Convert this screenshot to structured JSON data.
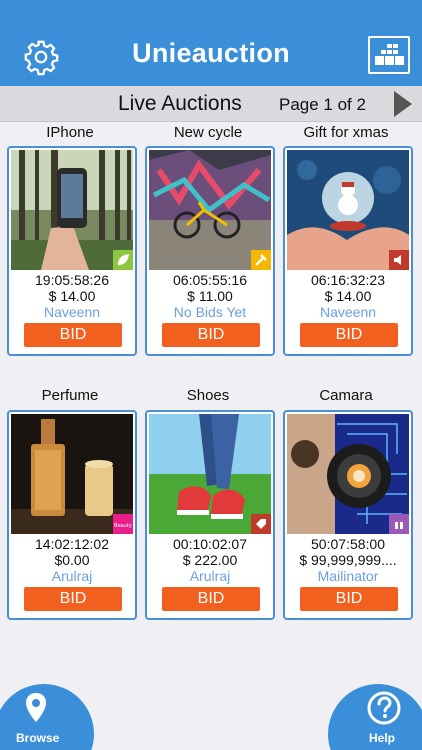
{
  "header": {
    "title": "Unieauction",
    "settings_icon": "gear-icon",
    "view_icon": "grid-view-icon"
  },
  "subbar": {
    "title": "Live Auctions",
    "page": "Page 1 of 2",
    "next_icon": "next-page-triangle-icon"
  },
  "items": [
    {
      "title": "IPhone",
      "time": "19:05:58:26",
      "price": "$ 14.00",
      "bidder": "Naveenn",
      "bid": "BID",
      "badge_color": "#8dc63f"
    },
    {
      "title": "New cycle",
      "time": "06:05:55:16",
      "price": "$ 11.00",
      "bidder": "No Bids Yet",
      "bid": "BID",
      "badge_color": "#f5b800"
    },
    {
      "title": "Gift for xmas",
      "time": "06:16:32:23",
      "price": "$ 14.00",
      "bidder": "Naveenn",
      "bid": "BID",
      "badge_color": "#c0392b"
    },
    {
      "title": "Perfume",
      "time": "14:02:12:02",
      "price": "$0.00",
      "bidder": "Arulraj",
      "bid": "BID",
      "badge_color": "#e91e8c"
    },
    {
      "title": "Shoes",
      "time": "00:10:02:07",
      "price": "$ 222.00",
      "bidder": "Arulraj",
      "bid": "BID",
      "badge_color": "#c0392b"
    },
    {
      "title": "Camara",
      "time": "50:07:58:00",
      "price": "$ 99,999,999....",
      "bidder": "Mailinator",
      "bid": "BID",
      "badge_color": "#9b59b6"
    }
  ],
  "bottom": {
    "browse_label": "Browse",
    "help_label": "Help"
  },
  "colors": {
    "brand": "#3a8fd8",
    "bid_button": "#f2601f",
    "bidder_text": "#6aa0df"
  }
}
